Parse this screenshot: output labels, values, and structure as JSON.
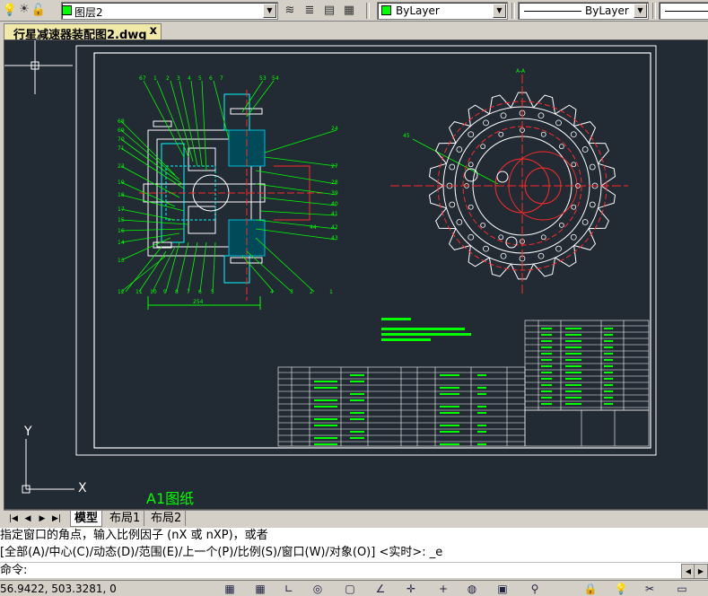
{
  "toolbar": {
    "layer_name": "图层2",
    "color_value": "ByLayer",
    "linetype_value": "ByLayer",
    "lineweight_value": "ByLayer",
    "layer_swatch": "#00ff00",
    "color_swatch": "#00ff00"
  },
  "document": {
    "tab_title": "行星减速器装配图2.dwg",
    "close_glyph": "x"
  },
  "canvas": {
    "background": "#222a34",
    "paper_label": "A1图纸",
    "ucs_x": "X",
    "ucs_y": "Y"
  },
  "drawing_labels": {
    "left_top": [
      "67",
      "1",
      "2",
      "3",
      "4",
      "5",
      "6",
      "7",
      "53",
      "54",
      "55"
    ],
    "left_side": [
      "68",
      "69",
      "70",
      "71",
      "23",
      "19",
      "18",
      "17",
      "15",
      "16",
      "14",
      "13"
    ],
    "left_bottom": [
      "12",
      "11",
      "10",
      "9",
      "8",
      "7",
      "6",
      "5",
      "4",
      "3",
      "2",
      "1"
    ],
    "right_side": [
      "24",
      "27",
      "28",
      "39",
      "40",
      "41",
      "42",
      "43",
      "44"
    ],
    "section_label": "A-A",
    "gear_label": "45",
    "dim_label": "254"
  },
  "layout_tabs": {
    "model": "模型",
    "layout1": "布局1",
    "layout2": "布局2"
  },
  "command": {
    "line1": "指定窗口的角点，输入比例因子 (nX 或 nXP)，或者",
    "line2": "[全部(A)/中心(C)/动态(D)/范围(E)/上一个(P)/比例(S)/窗口(W)/对象(O)] <实时>: _e",
    "prompt": "命令:"
  },
  "status": {
    "coordinates": "56.9422, 503.3281, 0"
  }
}
